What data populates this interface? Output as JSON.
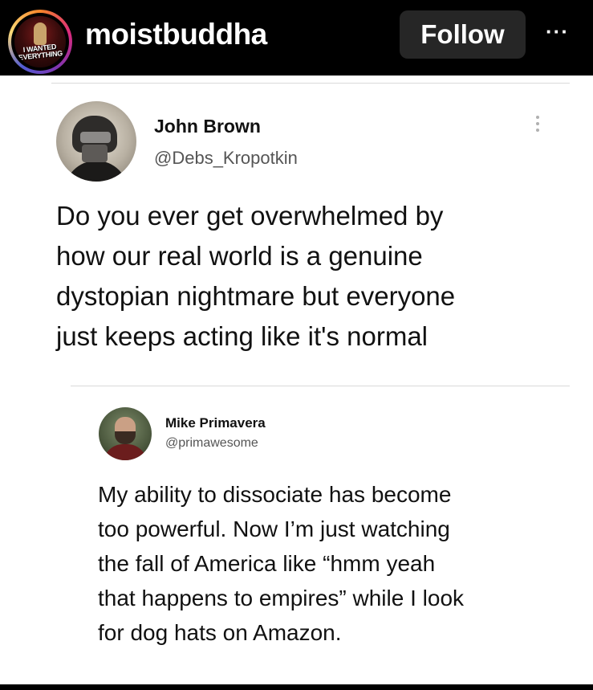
{
  "header": {
    "avatar_logo_text": "I WANTED EVERYTHING",
    "username": "moistbuddha",
    "follow_label": "Follow",
    "more_label": "···"
  },
  "tweet": {
    "name": "John Brown",
    "handle": "@Debs_Kropotkin",
    "text_lines": [
      "Do you ever get overwhelmed by",
      "how our real world is a genuine",
      "dystopian nightmare but everyone",
      "just keeps acting like it's normal"
    ]
  },
  "reply": {
    "name": "Mike Primavera",
    "handle": "@primawesome",
    "text_lines": [
      "My ability to dissociate has become",
      "too powerful. Now I’m just watching",
      "the fall of America like “hmm yeah",
      "that happens to empires” while I look",
      "for dog hats on Amazon."
    ]
  }
}
